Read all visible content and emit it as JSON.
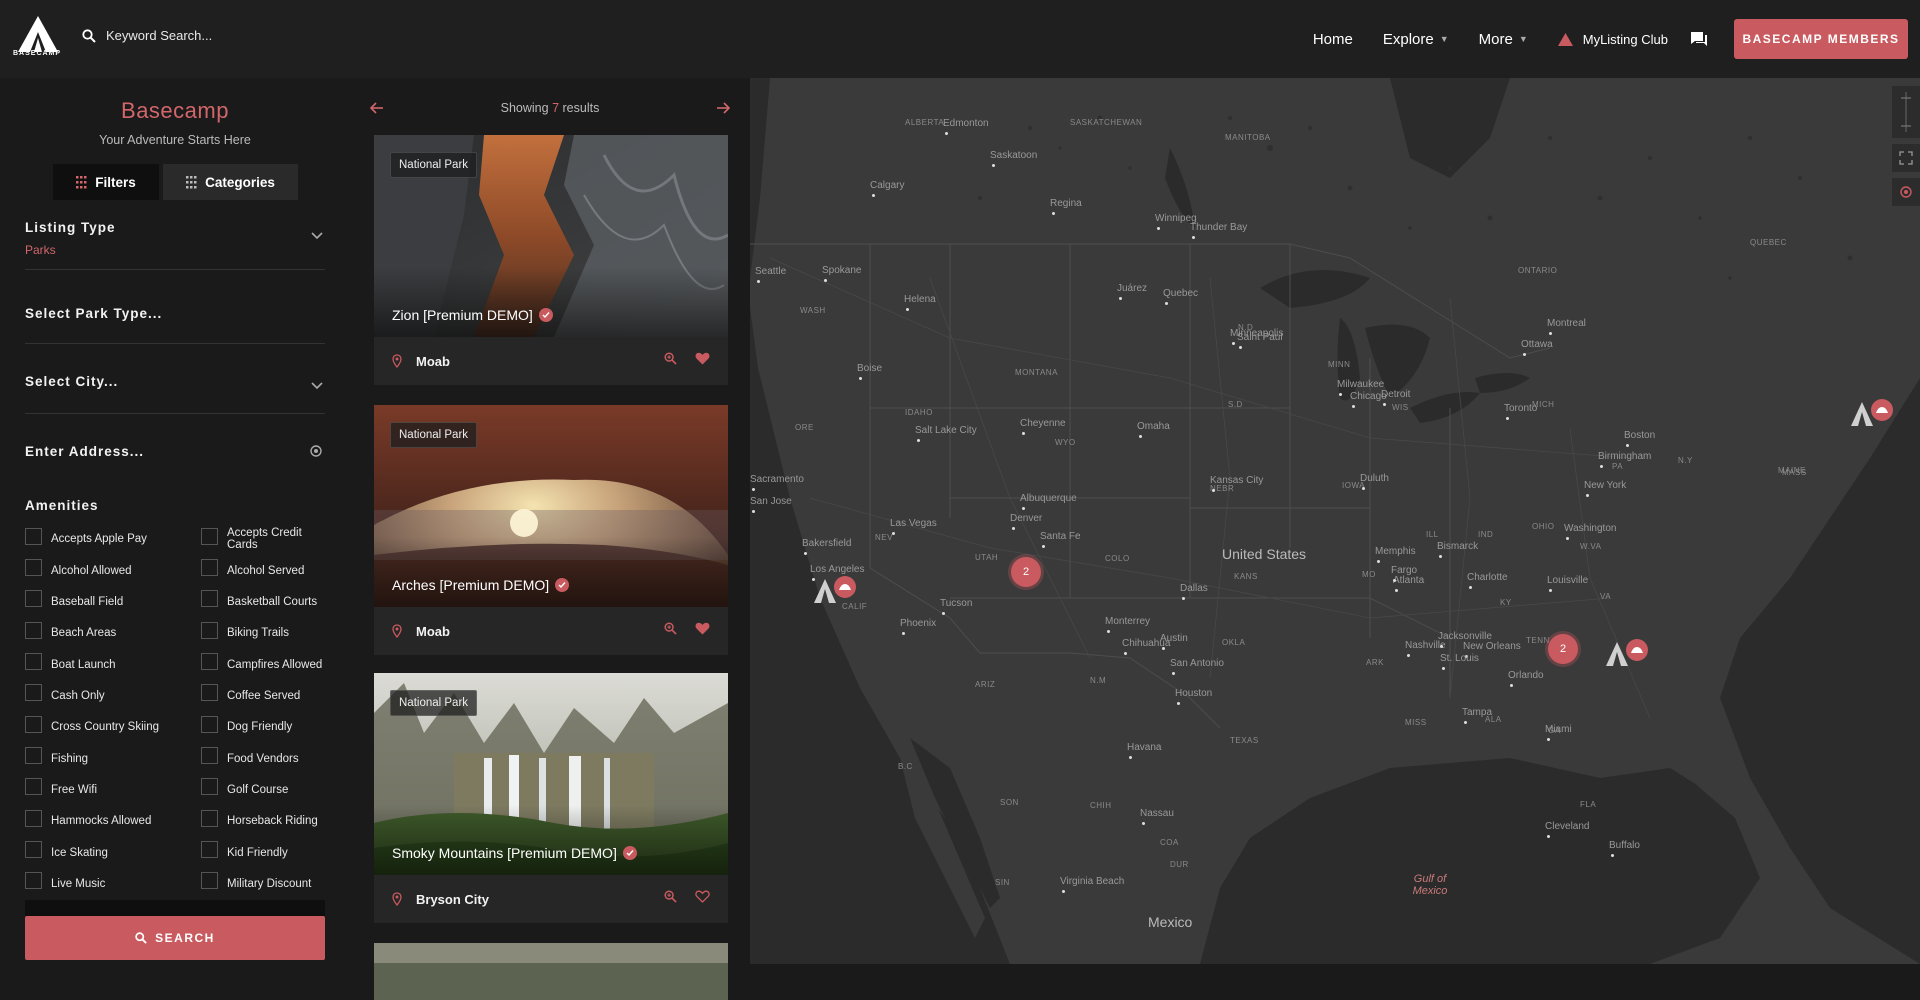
{
  "header": {
    "logo_text": "BASECAMP",
    "search_placeholder": "Keyword Search...",
    "nav": [
      {
        "label": "Home"
      },
      {
        "label": "Explore"
      },
      {
        "label": "More"
      }
    ],
    "club_label": "MyListing Club",
    "members_button": "BASECAMP MEMBERS"
  },
  "sidebar": {
    "title": "Basecamp",
    "subtitle": "Your Adventure Starts Here",
    "tabs": {
      "filters": "Filters",
      "categories": "Categories"
    },
    "listing_type": {
      "label": "Listing Type",
      "value": "Parks"
    },
    "park_type": {
      "label": "Select Park Type..."
    },
    "city": {
      "label": "Select City..."
    },
    "address": {
      "label": "Enter Address..."
    },
    "amenities_title": "Amenities",
    "amenities": [
      "Accepts Apple Pay",
      "Accepts Credit Cards",
      "Alcohol Allowed",
      "Alcohol Served",
      "Baseball Field",
      "Basketball Courts",
      "Beach Areas",
      "Biking Trails",
      "Boat Launch",
      "Campfires Allowed",
      "Cash Only",
      "Coffee Served",
      "Cross Country Skiing",
      "Dog Friendly",
      "Fishing",
      "Food Vendors",
      "Free Wifi",
      "Golf Course",
      "Hammocks Allowed",
      "Horseback Riding",
      "Ice Skating",
      "Kid Friendly",
      "Live Music",
      "Military Discount"
    ],
    "search_button": "SEARCH"
  },
  "results": {
    "showing_prefix": "Showing",
    "count": "7",
    "showing_suffix": "results",
    "cards": [
      {
        "badge": "National Park",
        "title": "Zion [Premium DEMO]",
        "location": "Moab",
        "favorited": true
      },
      {
        "badge": "National Park",
        "title": "Arches [Premium DEMO]",
        "location": "Moab",
        "favorited": true
      },
      {
        "badge": "National Park",
        "title": "Smoky Mountains [Premium DEMO]",
        "location": "Bryson City",
        "favorited": false
      }
    ]
  },
  "map": {
    "country_labels": [
      "United States",
      "Mexico"
    ],
    "water_label": "Gulf of Mexico",
    "clusters": [
      {
        "count": "2"
      },
      {
        "count": "2"
      }
    ],
    "city_labels": [
      "Edmonton",
      "Calgary",
      "Saskatoon",
      "Regina",
      "Winnipeg",
      "Seattle",
      "Spokane",
      "Helena",
      "Boise",
      "Salt Lake City",
      "Sacramento",
      "San Jose",
      "Las Vegas",
      "Los Angeles",
      "Bakersfield",
      "Phoenix",
      "Tucson",
      "Denver",
      "Cheyenne",
      "Albuquerque",
      "Santa Fe",
      "Omaha",
      "Kansas City",
      "Dallas",
      "Austin",
      "San Antonio",
      "Houston",
      "Minneapolis",
      "Saint Paul",
      "Chicago",
      "Milwaukee",
      "Detroit",
      "Toronto",
      "Montreal",
      "Ottawa",
      "Memphis",
      "Nashville",
      "Atlanta",
      "Jacksonville",
      "Orlando",
      "Miami",
      "Tampa",
      "New Orleans",
      "Boston",
      "New York",
      "Washington",
      "Charlotte",
      "Duluth",
      "Fargo",
      "Bismarck",
      "Thunder Bay",
      "Quebec",
      "Juárez",
      "Monterrey",
      "Chihuahua",
      "Havana",
      "Nassau",
      "Virginia Beach",
      "Cleveland",
      "Buffalo",
      "St. Louis",
      "Louisville",
      "Birmingham"
    ]
  },
  "colors": {
    "accent": "#c95a5f",
    "background": "#1a1a1a",
    "map": "#3a3a3a"
  }
}
